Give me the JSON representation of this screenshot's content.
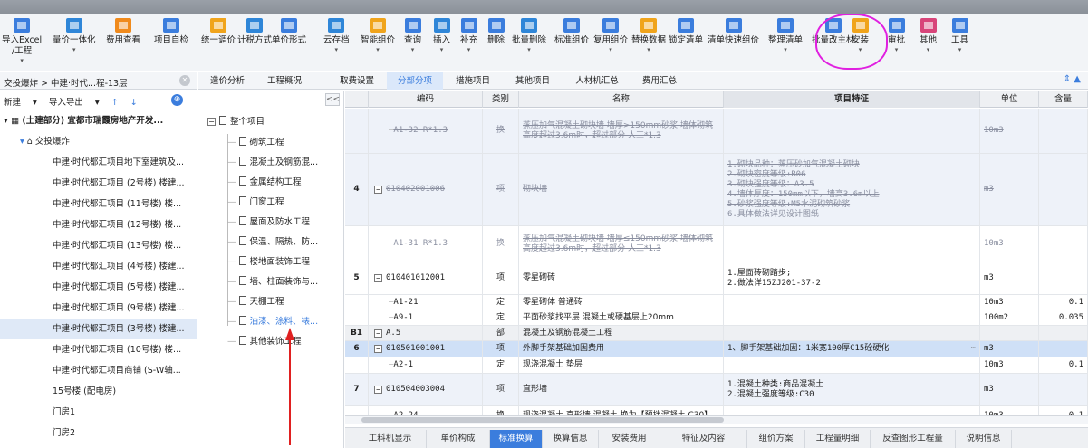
{
  "ribbon": {
    "buttons": [
      {
        "label": "导入Excel\n/工程",
        "icon": "import-excel-icon",
        "color": "#3b7ddd",
        "arrow": true
      },
      {
        "label": "量价一体化",
        "icon": "integration-icon",
        "color": "#2f86d8",
        "arrow": true
      },
      {
        "label": "费用查看",
        "icon": "cost-view-icon",
        "color": "#f08a1c"
      },
      {
        "label": "项目自检",
        "icon": "self-check-icon",
        "color": "#3b7ddd"
      },
      {
        "label": "统一调价",
        "icon": "unify-price-icon",
        "color": "#f0a41c"
      },
      {
        "label": "计税方式",
        "icon": "tax-mode-icon",
        "color": "#2f86d8"
      },
      {
        "label": "单价形式",
        "icon": "unit-price-icon",
        "color": "#3b7ddd"
      },
      {
        "label": "云存档",
        "icon": "cloud-save-icon",
        "color": "#2f86d8",
        "arrow": true
      },
      {
        "label": "智能组价",
        "icon": "smart-price-icon",
        "color": "#f0a41c",
        "arrow": true
      },
      {
        "label": "查询",
        "icon": "search-icon",
        "color": "#3b7ddd",
        "arrow": true
      },
      {
        "label": "插入",
        "icon": "insert-icon",
        "color": "#2f86d8",
        "arrow": true
      },
      {
        "label": "补充",
        "icon": "supplement-icon",
        "color": "#3b7ddd",
        "arrow": true
      },
      {
        "label": "删除",
        "icon": "delete-icon",
        "color": "#3b7ddd"
      },
      {
        "label": "批量删除",
        "icon": "batch-delete-icon",
        "color": "#2f86d8",
        "arrow": true
      },
      {
        "label": "标准组价",
        "icon": "standard-price-icon",
        "color": "#3b7ddd"
      },
      {
        "label": "复用组价",
        "icon": "reuse-price-icon",
        "color": "#3b7ddd",
        "arrow": true
      },
      {
        "label": "替换数据",
        "icon": "replace-data-icon",
        "color": "#f0a41c",
        "arrow": true
      },
      {
        "label": "锁定清单",
        "icon": "lock-list-icon",
        "color": "#3b7ddd"
      },
      {
        "label": "清单快速组价",
        "icon": "quick-price-icon",
        "color": "#3b7ddd"
      },
      {
        "label": "整理清单",
        "icon": "arrange-list-icon",
        "color": "#3b7ddd",
        "arrow": true
      },
      {
        "label": "批量改主材",
        "icon": "batch-material-icon",
        "color": "#3b7ddd"
      },
      {
        "label": "安装",
        "icon": "install-icon",
        "color": "#f0a41c",
        "arrow": true
      },
      {
        "label": "审批",
        "icon": "approve-icon",
        "color": "#3b7ddd",
        "arrow": true
      },
      {
        "label": "其他",
        "icon": "other-icon",
        "color": "#d8457a",
        "arrow": true
      },
      {
        "label": "工具",
        "icon": "tools-icon",
        "color": "#3b7ddd",
        "arrow": true
      }
    ]
  },
  "breadcrumb": {
    "text": "交投爆炸 > 中建·时代...程-13层"
  },
  "left_toolbar": {
    "new_label": "新建",
    "import_label": "导入导出",
    "up": "↑",
    "down": "↓"
  },
  "project_tree": {
    "items": [
      {
        "label": "(土建部分) 宜都市瑞霞房地产开发...",
        "level": 0,
        "bold": true
      },
      {
        "label": "交投爆炸",
        "level": 1
      },
      {
        "label": "中建·时代都汇项目地下室建筑及...",
        "level": 2
      },
      {
        "label": "中建·时代都汇项目 (2号楼) 楼建...",
        "level": 2
      },
      {
        "label": "中建·时代都汇项目 (11号楼) 楼...",
        "level": 2
      },
      {
        "label": "中建·时代都汇项目 (12号楼) 楼...",
        "level": 2
      },
      {
        "label": "中建·时代都汇项目 (13号楼) 楼...",
        "level": 2
      },
      {
        "label": "中建·时代都汇项目 (4号楼) 楼建...",
        "level": 2
      },
      {
        "label": "中建·时代都汇项目 (5号楼) 楼建...",
        "level": 2
      },
      {
        "label": "中建·时代都汇项目 (9号楼) 楼建...",
        "level": 2
      },
      {
        "label": "中建·时代都汇项目 (3号楼) 楼建...",
        "level": 2,
        "selected": true
      },
      {
        "label": "中建·时代都汇项目 (10号楼) 楼...",
        "level": 2
      },
      {
        "label": "中建·时代都汇项目商铺 (S-W轴...",
        "level": 2
      },
      {
        "label": "15号楼 (配电房)",
        "level": 2
      },
      {
        "label": "门房1",
        "level": 2
      },
      {
        "label": "门房2",
        "level": 2
      }
    ]
  },
  "top_tabs": [
    {
      "label": "造价分析"
    },
    {
      "label": "工程概况"
    },
    {
      "label": "取费设置"
    },
    {
      "label": "分部分项",
      "active": true
    },
    {
      "label": "措施项目"
    },
    {
      "label": "其他项目"
    },
    {
      "label": "人材机汇总"
    },
    {
      "label": "费用汇总"
    }
  ],
  "division_tree": {
    "root": "整个项目",
    "collapse": "<<",
    "items": [
      {
        "label": "砌筑工程"
      },
      {
        "label": "混凝土及钢筋混..."
      },
      {
        "label": "金属结构工程"
      },
      {
        "label": "门窗工程"
      },
      {
        "label": "屋面及防水工程"
      },
      {
        "label": "保温、隔热、防..."
      },
      {
        "label": "楼地面装饰工程"
      },
      {
        "label": "墙、柱面装饰与..."
      },
      {
        "label": "天棚工程"
      },
      {
        "label": "油漆、涂料、裱...",
        "blue": true
      },
      {
        "label": "其他装饰工程"
      }
    ]
  },
  "table": {
    "headers": [
      "",
      "编码",
      "类别",
      "名称",
      "项目特征",
      "单位",
      "含量"
    ],
    "rows": [
      {
        "no": "",
        "code": "A1-32 R*1.3",
        "type": "换",
        "name": "蒸压加气混凝土砌块墙 墙厚>150mm砂浆 墙体砌筑高度超过3.6m时，超过部分 人工*1.3",
        "feature": "",
        "unit": "10m3",
        "qty": "",
        "strike": true,
        "sub": true,
        "shaded": true
      },
      {
        "no": "4",
        "code": "010402001006",
        "type": "项",
        "name": "砌块墙",
        "feature": "1.砌块品种：蒸压砂加气混凝土砌块\n2.砌块密度等级:B06\n3.砌块强度等级：A3.5\n4.墙体厚度：150mm以下，墙高3.6m以上\n5.砂浆强度等级:M5水泥砌筑砂浆\n6.具体做法详见设计图纸",
        "unit": "m3",
        "qty": "",
        "strike": true,
        "minus": true,
        "shaded": true
      },
      {
        "no": "",
        "code": "A1-31 R*1.3",
        "type": "换",
        "name": "蒸压加气混凝土砌块墙 墙厚≤150mm砂浆 墙体砌筑高度超过3.6m时，超过部分 人工*1.3",
        "feature": "",
        "unit": "10m3",
        "qty": "",
        "strike": true,
        "sub": true
      },
      {
        "no": "5",
        "code": "010401012001",
        "type": "项",
        "name": "零星砌砖",
        "feature": "1.屋面砖砌踏步;\n2.做法详15ZJ201-37-2",
        "unit": "m3",
        "qty": "",
        "minus": true
      },
      {
        "no": "",
        "code": "A1-21",
        "type": "定",
        "name": "零星砌体 普通砖",
        "feature": "",
        "unit": "10m3",
        "qty": "0.1",
        "sub": true
      },
      {
        "no": "",
        "code": "A9-1",
        "type": "定",
        "name": "平面砂浆找平层 混凝土或硬基层上20mm",
        "feature": "",
        "unit": "100m2",
        "qty": "0.035",
        "sub": true
      },
      {
        "no": "B1",
        "code": "A.5",
        "type": "部",
        "name": "混凝土及钢筋混凝土工程",
        "feature": "",
        "unit": "",
        "qty": "",
        "minus": true,
        "b1": true
      },
      {
        "no": "6",
        "code": "010501001001",
        "type": "项",
        "name": "外脚手架基础加固费用",
        "feature": "1、脚手架基础加固：1米宽100厚C15砼硬化",
        "unit": "m3",
        "qty": "",
        "minus": true,
        "selected": true
      },
      {
        "no": "",
        "code": "A2-1",
        "type": "定",
        "name": "现浇混凝土 垫层",
        "feature": "",
        "unit": "10m3",
        "qty": "0.1",
        "sub": true
      },
      {
        "no": "7",
        "code": "010504003004",
        "type": "项",
        "name": "直形墙",
        "feature": "1.混凝土种类:商品混凝土\n2.混凝土强度等级:C30",
        "unit": "m3",
        "qty": "",
        "minus": true,
        "shaded": true
      },
      {
        "no": "",
        "code": "A2-24",
        "type": "换",
        "name": "现浇混凝土 直形墙 混凝土 换为【预拌混凝土 C30】",
        "feature": "",
        "unit": "10m3",
        "qty": "0.1",
        "sub": true
      }
    ]
  },
  "bottom_tabs": [
    {
      "label": "工料机显示"
    },
    {
      "label": "单价构成"
    },
    {
      "label": "标准换算",
      "active": true
    },
    {
      "label": "换算信息"
    },
    {
      "label": "安装费用"
    },
    {
      "label": "特征及内容"
    },
    {
      "label": "组价方案"
    },
    {
      "label": "工程量明细"
    },
    {
      "label": "反查图形工程量"
    },
    {
      "label": "说明信息"
    }
  ],
  "colors": {
    "accent": "#3b7ddd",
    "highlight_circle": "#e020e0",
    "arrow": "#e02020"
  }
}
